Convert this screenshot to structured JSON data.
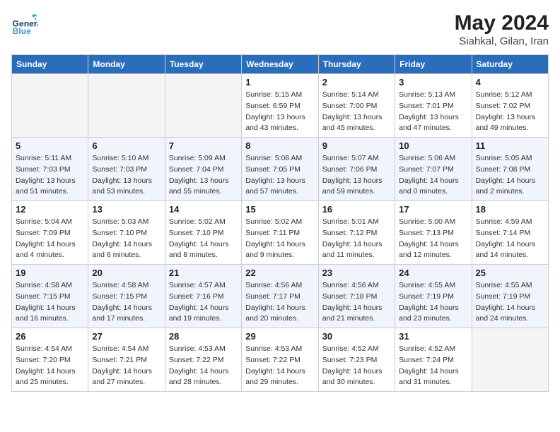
{
  "header": {
    "logo_general": "General",
    "logo_blue": "Blue",
    "month_year": "May 2024",
    "location": "Siahkal, Gilan, Iran"
  },
  "days_of_week": [
    "Sunday",
    "Monday",
    "Tuesday",
    "Wednesday",
    "Thursday",
    "Friday",
    "Saturday"
  ],
  "weeks": [
    [
      {
        "day": "",
        "info": []
      },
      {
        "day": "",
        "info": []
      },
      {
        "day": "",
        "info": []
      },
      {
        "day": "1",
        "info": [
          "Sunrise: 5:15 AM",
          "Sunset: 6:59 PM",
          "Daylight: 13 hours",
          "and 43 minutes."
        ]
      },
      {
        "day": "2",
        "info": [
          "Sunrise: 5:14 AM",
          "Sunset: 7:00 PM",
          "Daylight: 13 hours",
          "and 45 minutes."
        ]
      },
      {
        "day": "3",
        "info": [
          "Sunrise: 5:13 AM",
          "Sunset: 7:01 PM",
          "Daylight: 13 hours",
          "and 47 minutes."
        ]
      },
      {
        "day": "4",
        "info": [
          "Sunrise: 5:12 AM",
          "Sunset: 7:02 PM",
          "Daylight: 13 hours",
          "and 49 minutes."
        ]
      }
    ],
    [
      {
        "day": "5",
        "info": [
          "Sunrise: 5:11 AM",
          "Sunset: 7:03 PM",
          "Daylight: 13 hours",
          "and 51 minutes."
        ]
      },
      {
        "day": "6",
        "info": [
          "Sunrise: 5:10 AM",
          "Sunset: 7:03 PM",
          "Daylight: 13 hours",
          "and 53 minutes."
        ]
      },
      {
        "day": "7",
        "info": [
          "Sunrise: 5:09 AM",
          "Sunset: 7:04 PM",
          "Daylight: 13 hours",
          "and 55 minutes."
        ]
      },
      {
        "day": "8",
        "info": [
          "Sunrise: 5:08 AM",
          "Sunset: 7:05 PM",
          "Daylight: 13 hours",
          "and 57 minutes."
        ]
      },
      {
        "day": "9",
        "info": [
          "Sunrise: 5:07 AM",
          "Sunset: 7:06 PM",
          "Daylight: 13 hours",
          "and 59 minutes."
        ]
      },
      {
        "day": "10",
        "info": [
          "Sunrise: 5:06 AM",
          "Sunset: 7:07 PM",
          "Daylight: 14 hours",
          "and 0 minutes."
        ]
      },
      {
        "day": "11",
        "info": [
          "Sunrise: 5:05 AM",
          "Sunset: 7:08 PM",
          "Daylight: 14 hours",
          "and 2 minutes."
        ]
      }
    ],
    [
      {
        "day": "12",
        "info": [
          "Sunrise: 5:04 AM",
          "Sunset: 7:09 PM",
          "Daylight: 14 hours",
          "and 4 minutes."
        ]
      },
      {
        "day": "13",
        "info": [
          "Sunrise: 5:03 AM",
          "Sunset: 7:10 PM",
          "Daylight: 14 hours",
          "and 6 minutes."
        ]
      },
      {
        "day": "14",
        "info": [
          "Sunrise: 5:02 AM",
          "Sunset: 7:10 PM",
          "Daylight: 14 hours",
          "and 8 minutes."
        ]
      },
      {
        "day": "15",
        "info": [
          "Sunrise: 5:02 AM",
          "Sunset: 7:11 PM",
          "Daylight: 14 hours",
          "and 9 minutes."
        ]
      },
      {
        "day": "16",
        "info": [
          "Sunrise: 5:01 AM",
          "Sunset: 7:12 PM",
          "Daylight: 14 hours",
          "and 11 minutes."
        ]
      },
      {
        "day": "17",
        "info": [
          "Sunrise: 5:00 AM",
          "Sunset: 7:13 PM",
          "Daylight: 14 hours",
          "and 12 minutes."
        ]
      },
      {
        "day": "18",
        "info": [
          "Sunrise: 4:59 AM",
          "Sunset: 7:14 PM",
          "Daylight: 14 hours",
          "and 14 minutes."
        ]
      }
    ],
    [
      {
        "day": "19",
        "info": [
          "Sunrise: 4:58 AM",
          "Sunset: 7:15 PM",
          "Daylight: 14 hours",
          "and 16 minutes."
        ]
      },
      {
        "day": "20",
        "info": [
          "Sunrise: 4:58 AM",
          "Sunset: 7:15 PM",
          "Daylight: 14 hours",
          "and 17 minutes."
        ]
      },
      {
        "day": "21",
        "info": [
          "Sunrise: 4:57 AM",
          "Sunset: 7:16 PM",
          "Daylight: 14 hours",
          "and 19 minutes."
        ]
      },
      {
        "day": "22",
        "info": [
          "Sunrise: 4:56 AM",
          "Sunset: 7:17 PM",
          "Daylight: 14 hours",
          "and 20 minutes."
        ]
      },
      {
        "day": "23",
        "info": [
          "Sunrise: 4:56 AM",
          "Sunset: 7:18 PM",
          "Daylight: 14 hours",
          "and 21 minutes."
        ]
      },
      {
        "day": "24",
        "info": [
          "Sunrise: 4:55 AM",
          "Sunset: 7:19 PM",
          "Daylight: 14 hours",
          "and 23 minutes."
        ]
      },
      {
        "day": "25",
        "info": [
          "Sunrise: 4:55 AM",
          "Sunset: 7:19 PM",
          "Daylight: 14 hours",
          "and 24 minutes."
        ]
      }
    ],
    [
      {
        "day": "26",
        "info": [
          "Sunrise: 4:54 AM",
          "Sunset: 7:20 PM",
          "Daylight: 14 hours",
          "and 25 minutes."
        ]
      },
      {
        "day": "27",
        "info": [
          "Sunrise: 4:54 AM",
          "Sunset: 7:21 PM",
          "Daylight: 14 hours",
          "and 27 minutes."
        ]
      },
      {
        "day": "28",
        "info": [
          "Sunrise: 4:53 AM",
          "Sunset: 7:22 PM",
          "Daylight: 14 hours",
          "and 28 minutes."
        ]
      },
      {
        "day": "29",
        "info": [
          "Sunrise: 4:53 AM",
          "Sunset: 7:22 PM",
          "Daylight: 14 hours",
          "and 29 minutes."
        ]
      },
      {
        "day": "30",
        "info": [
          "Sunrise: 4:52 AM",
          "Sunset: 7:23 PM",
          "Daylight: 14 hours",
          "and 30 minutes."
        ]
      },
      {
        "day": "31",
        "info": [
          "Sunrise: 4:52 AM",
          "Sunset: 7:24 PM",
          "Daylight: 14 hours",
          "and 31 minutes."
        ]
      },
      {
        "day": "",
        "info": []
      }
    ]
  ]
}
